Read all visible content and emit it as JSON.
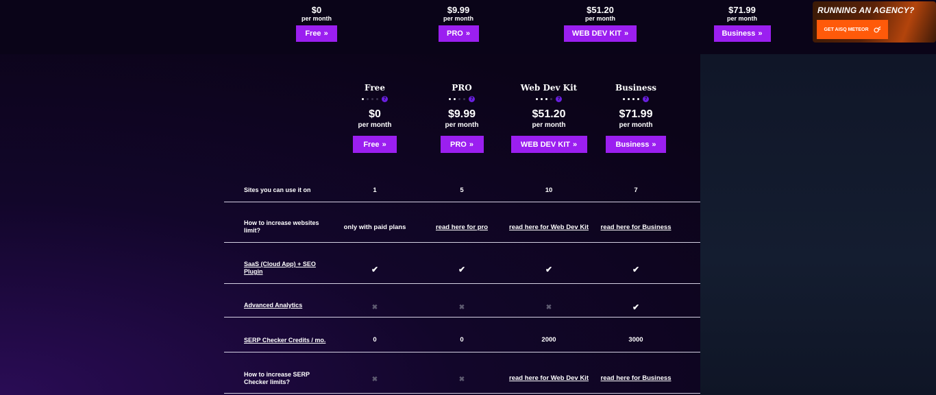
{
  "sticky_plans": [
    {
      "price": "$0",
      "per": "per month",
      "button": "Free"
    },
    {
      "price": "$9.99",
      "per": "per month",
      "button": "PRO"
    },
    {
      "price": "$51.20",
      "per": "per month",
      "button": "WEB DEV KIT"
    },
    {
      "price": "$71.99",
      "per": "per month",
      "button": "Business"
    }
  ],
  "ad": {
    "title": "RUNNING AN AGENCY?",
    "button": "GET AISQ METEOR"
  },
  "plans": [
    {
      "name": "Free",
      "level": 1,
      "price": "$0",
      "per": "per month",
      "button": "Free"
    },
    {
      "name": "PRO",
      "level": 2,
      "price": "$9.99",
      "per": "per month",
      "button": "PRO"
    },
    {
      "name": "Web Dev Kit",
      "level": 3,
      "price": "$51.20",
      "per": "per month",
      "button": "WEB DEV KIT"
    },
    {
      "name": "Business",
      "level": 4,
      "price": "$71.99",
      "per": "per month",
      "button": "Business"
    }
  ],
  "rows": [
    {
      "label": "Sites you can use it on",
      "label_link": false,
      "cells": [
        {
          "t": "text",
          "v": "1"
        },
        {
          "t": "text",
          "v": "5"
        },
        {
          "t": "text",
          "v": "10"
        },
        {
          "t": "text",
          "v": "7"
        }
      ]
    },
    {
      "label": "How to increase websites limit?",
      "label_link": false,
      "cells": [
        {
          "t": "text",
          "v": "only with paid plans"
        },
        {
          "t": "link",
          "v": "read here for pro"
        },
        {
          "t": "link",
          "v": "read here for Web Dev Kit"
        },
        {
          "t": "link",
          "v": "read here for Business"
        }
      ]
    },
    {
      "label": "SaaS (Cloud App) + SEO Plugin",
      "label_link": true,
      "cells": [
        {
          "t": "check"
        },
        {
          "t": "check"
        },
        {
          "t": "check"
        },
        {
          "t": "check"
        }
      ]
    },
    {
      "label": "Advanced Analytics",
      "label_link": true,
      "cells": [
        {
          "t": "cross"
        },
        {
          "t": "cross"
        },
        {
          "t": "cross"
        },
        {
          "t": "check"
        }
      ]
    },
    {
      "label": "SERP Checker Credits / mo.",
      "label_link": true,
      "cells": [
        {
          "t": "text",
          "v": "0"
        },
        {
          "t": "text",
          "v": "0"
        },
        {
          "t": "text",
          "v": "2000"
        },
        {
          "t": "text",
          "v": "3000"
        }
      ]
    },
    {
      "label": "How to increase SERP Checker limits?",
      "label_link": false,
      "cells": [
        {
          "t": "cross"
        },
        {
          "t": "cross"
        },
        {
          "t": "link",
          "v": "read here for Web Dev Kit"
        },
        {
          "t": "link",
          "v": "read here for Business"
        }
      ]
    }
  ]
}
